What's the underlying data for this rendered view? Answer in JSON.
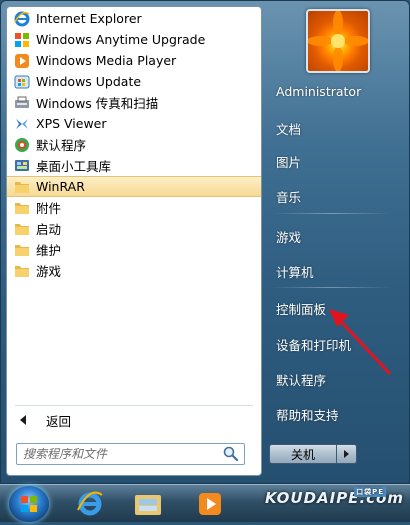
{
  "programs": [
    {
      "label": "Internet Explorer",
      "icon": "internet-explorer-icon"
    },
    {
      "label": "Windows Anytime Upgrade",
      "icon": "windows-logo-icon"
    },
    {
      "label": "Windows Media Player",
      "icon": "media-player-icon"
    },
    {
      "label": "Windows Update",
      "icon": "windows-update-icon"
    },
    {
      "label": "Windows 传真和扫描",
      "icon": "fax-scan-icon"
    },
    {
      "label": "XPS Viewer",
      "icon": "xps-viewer-icon"
    },
    {
      "label": "默认程序",
      "icon": "default-programs-icon"
    },
    {
      "label": "桌面小工具库",
      "icon": "gadgets-icon"
    },
    {
      "label": "WinRAR",
      "icon": "folder-icon",
      "selected": true
    },
    {
      "label": "附件",
      "icon": "folder-icon"
    },
    {
      "label": "启动",
      "icon": "folder-icon"
    },
    {
      "label": "维护",
      "icon": "folder-icon"
    },
    {
      "label": "游戏",
      "icon": "folder-icon"
    }
  ],
  "back_label": "返回",
  "search": {
    "placeholder": "搜索程序和文件"
  },
  "right_panel": {
    "user": "Administrator",
    "documents": "文档",
    "pictures": "图片",
    "music": "音乐",
    "games": "游戏",
    "computer": "计算机",
    "control_panel": "控制面板",
    "devices_printers": "设备和打印机",
    "default_programs": "默认程序",
    "help_support": "帮助和支持"
  },
  "shutdown_label": "关机",
  "taskbar": {
    "watermark": "KOUDAIPE.com",
    "watermark_badge": "口袋PE"
  },
  "colors": {
    "selected_highlight": "#f7d993",
    "annotation_arrow": "#e0141e"
  }
}
